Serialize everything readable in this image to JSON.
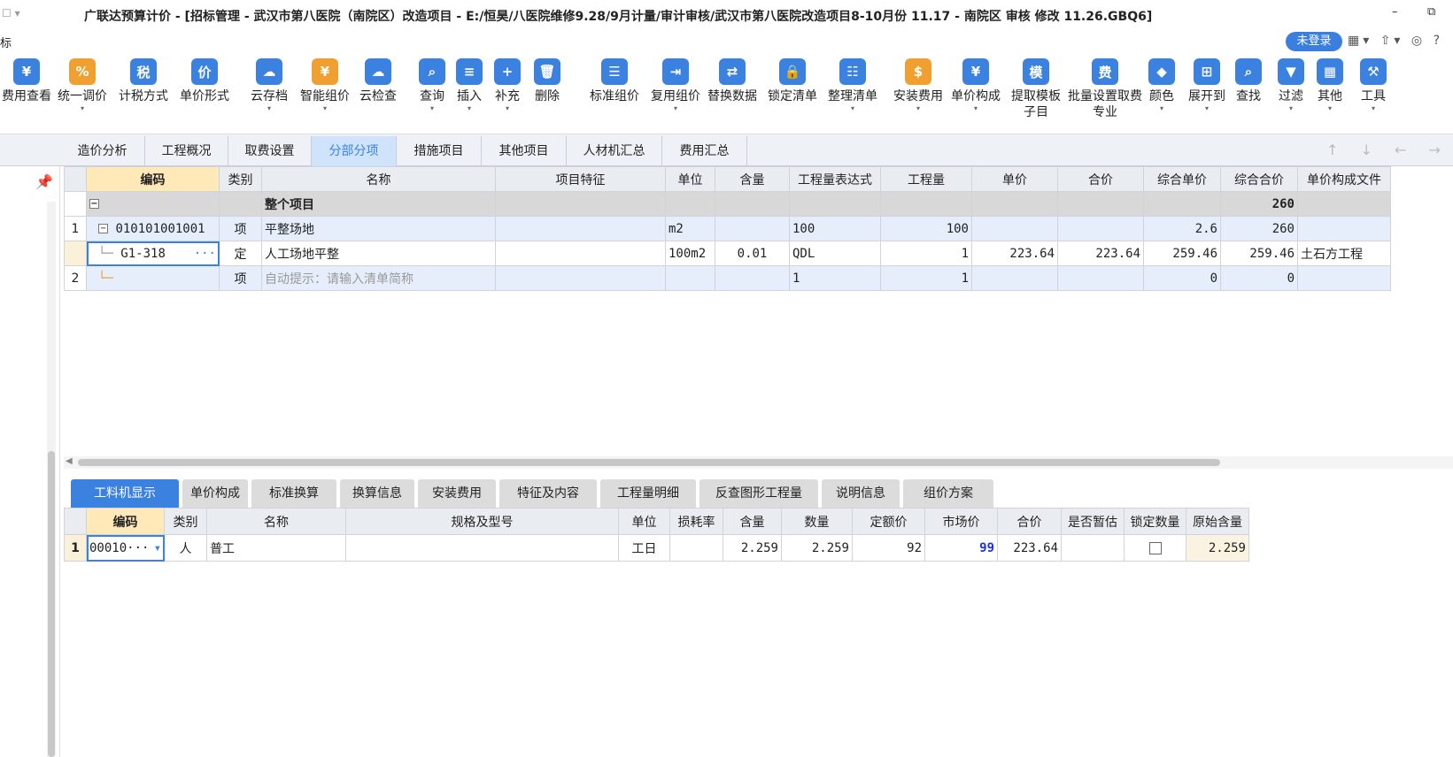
{
  "window": {
    "title": "广联达预算计价 - [招标管理 - 武汉市第八医院（南院区）改造项目 - E:/恒昊/八医院维修9.28/9月计量/审计审核/武汉市第八医院改造项目8-10月份 11.17 - 南院区    审核 修改 11.26.GBQ6]",
    "quick_access": "☐ ▾",
    "minimize": "–",
    "maximize": "⧉"
  },
  "menubar": {
    "first_item": "标",
    "login_label": "未登录",
    "right_icons": "▦▾ ⇧▾ ◎ ?"
  },
  "toolbar": [
    {
      "label": "费用查看",
      "icon": "fee-view-icon",
      "color": "#3b82e0",
      "glyph": "¥",
      "caret": false
    },
    {
      "label": "统一调价",
      "icon": "unified-adjust-icon",
      "color": "#f0a030",
      "glyph": "%",
      "caret": true
    },
    {
      "label": "计税方式",
      "icon": "tax-method-icon",
      "color": "#3b82e0",
      "glyph": "税",
      "caret": false
    },
    {
      "label": "单价形式",
      "icon": "unit-price-form-icon",
      "color": "#3b82e0",
      "glyph": "价",
      "caret": false
    },
    {
      "label": "云存档",
      "icon": "cloud-archive-icon",
      "color": "#3b82e0",
      "glyph": "☁",
      "caret": true
    },
    {
      "label": "智能组价",
      "icon": "smart-price-icon",
      "color": "#f0a030",
      "glyph": "¥",
      "caret": true
    },
    {
      "label": "云检查",
      "icon": "cloud-check-icon",
      "color": "#3b82e0",
      "glyph": "☁",
      "caret": false
    },
    {
      "label": "查询",
      "icon": "query-icon",
      "color": "#3b82e0",
      "glyph": "⌕",
      "caret": true
    },
    {
      "label": "插入",
      "icon": "insert-icon",
      "color": "#3b82e0",
      "glyph": "≡",
      "caret": true
    },
    {
      "label": "补充",
      "icon": "supplement-icon",
      "color": "#3b82e0",
      "glyph": "+",
      "caret": true
    },
    {
      "label": "删除",
      "icon": "delete-icon",
      "color": "#3b82e0",
      "glyph": "🗑",
      "caret": false
    },
    {
      "label": "标准组价",
      "icon": "standard-price-icon",
      "color": "#3b82e0",
      "glyph": "☰",
      "caret": false
    },
    {
      "label": "复用组价",
      "icon": "reuse-price-icon",
      "color": "#3b82e0",
      "glyph": "⇥",
      "caret": true
    },
    {
      "label": "替换数据",
      "icon": "replace-data-icon",
      "color": "#3b82e0",
      "glyph": "⇄",
      "caret": false
    },
    {
      "label": "锁定清单",
      "icon": "lock-list-icon",
      "color": "#3b82e0",
      "glyph": "🔒",
      "caret": false
    },
    {
      "label": "整理清单",
      "icon": "organize-list-icon",
      "color": "#3b82e0",
      "glyph": "☷",
      "caret": true
    },
    {
      "label": "安装费用",
      "icon": "install-fee-icon",
      "color": "#f0a030",
      "glyph": "$",
      "caret": true
    },
    {
      "label": "单价构成",
      "icon": "price-composition-icon",
      "color": "#3b82e0",
      "glyph": "¥",
      "caret": true
    },
    {
      "label": "提取模板子目",
      "icon": "template-icon",
      "color": "#3b82e0",
      "glyph": "模",
      "caret": false
    },
    {
      "label": "批量设置取费专业",
      "icon": "batch-fee-icon",
      "color": "#3b82e0",
      "glyph": "费",
      "caret": false
    },
    {
      "label": "颜色",
      "icon": "color-icon",
      "color": "#3b82e0",
      "glyph": "◆",
      "caret": true
    },
    {
      "label": "展开到",
      "icon": "expand-to-icon",
      "color": "#3b82e0",
      "glyph": "⊞",
      "caret": true
    },
    {
      "label": "查找",
      "icon": "find-icon",
      "color": "#3b82e0",
      "glyph": "⌕",
      "caret": false
    },
    {
      "label": "过滤",
      "icon": "filter-icon",
      "color": "#3b82e0",
      "glyph": "▼",
      "caret": true
    },
    {
      "label": "其他",
      "icon": "other-icon",
      "color": "#3b82e0",
      "glyph": "▦",
      "caret": true
    },
    {
      "label": "工具",
      "icon": "tool-icon",
      "color": "#3b82e0",
      "glyph": "⚒",
      "caret": true
    }
  ],
  "tabs": [
    "造价分析",
    "工程概况",
    "取费设置",
    "分部分项",
    "措施项目",
    "其他项目",
    "人材机汇总",
    "费用汇总"
  ],
  "active_tab": "分部分项",
  "nav_arrows": "↑ ↓ ← →",
  "grid": {
    "headers": [
      "编码",
      "类别",
      "名称",
      "项目特征",
      "单位",
      "含量",
      "工程量表达式",
      "工程量",
      "单价",
      "合价",
      "综合单价",
      "综合合价",
      "单价构成文件"
    ],
    "group_row": {
      "name": "整个项目",
      "total": "260"
    },
    "rows": [
      {
        "no": "1",
        "code": "010101001001",
        "type": "项",
        "name": "平整场地",
        "feature": "",
        "unit": "m2",
        "content": "",
        "expr": "100",
        "qty": "100",
        "price": "",
        "total": "",
        "comp_price": "2.6",
        "comp_total": "260",
        "file": ""
      },
      {
        "no": "",
        "code": "G1-318",
        "type": "定",
        "name": "人工场地平整",
        "feature": "",
        "unit": "100m2",
        "content": "0.01",
        "expr": "QDL",
        "qty": "1",
        "price": "223.64",
        "total": "223.64",
        "comp_price": "259.46",
        "comp_total": "259.46",
        "file": "土石方工程"
      },
      {
        "no": "2",
        "code": "",
        "type": "项",
        "name": "自动提示：请输入清单简称",
        "feature": "",
        "unit": "",
        "content": "",
        "expr": "1",
        "qty": "1",
        "price": "",
        "total": "",
        "comp_price": "0",
        "comp_total": "0",
        "file": ""
      }
    ],
    "more_button": "···",
    "expand_sign": "−"
  },
  "bottom_tabs": [
    "工料机显示",
    "单价构成",
    "标准换算",
    "换算信息",
    "安装费用",
    "特征及内容",
    "工程量明细",
    "反查图形工程量",
    "说明信息",
    "组价方案"
  ],
  "bottom_active": "工料机显示",
  "bottom_grid": {
    "headers": [
      "编码",
      "类别",
      "名称",
      "规格及型号",
      "单位",
      "损耗率",
      "含量",
      "数量",
      "定额价",
      "市场价",
      "合价",
      "是否暂估",
      "锁定数量",
      "原始含量"
    ],
    "rows": [
      {
        "no": "1",
        "code": "00010···",
        "type": "人",
        "name": "普工",
        "spec": "",
        "unit": "工日",
        "loss": "",
        "content": "2.259",
        "qty": "2.259",
        "quota_price": "92",
        "market_price": "99",
        "total": "223.64",
        "estimate": "",
        "lock": false,
        "orig_content": "2.259"
      }
    ]
  }
}
